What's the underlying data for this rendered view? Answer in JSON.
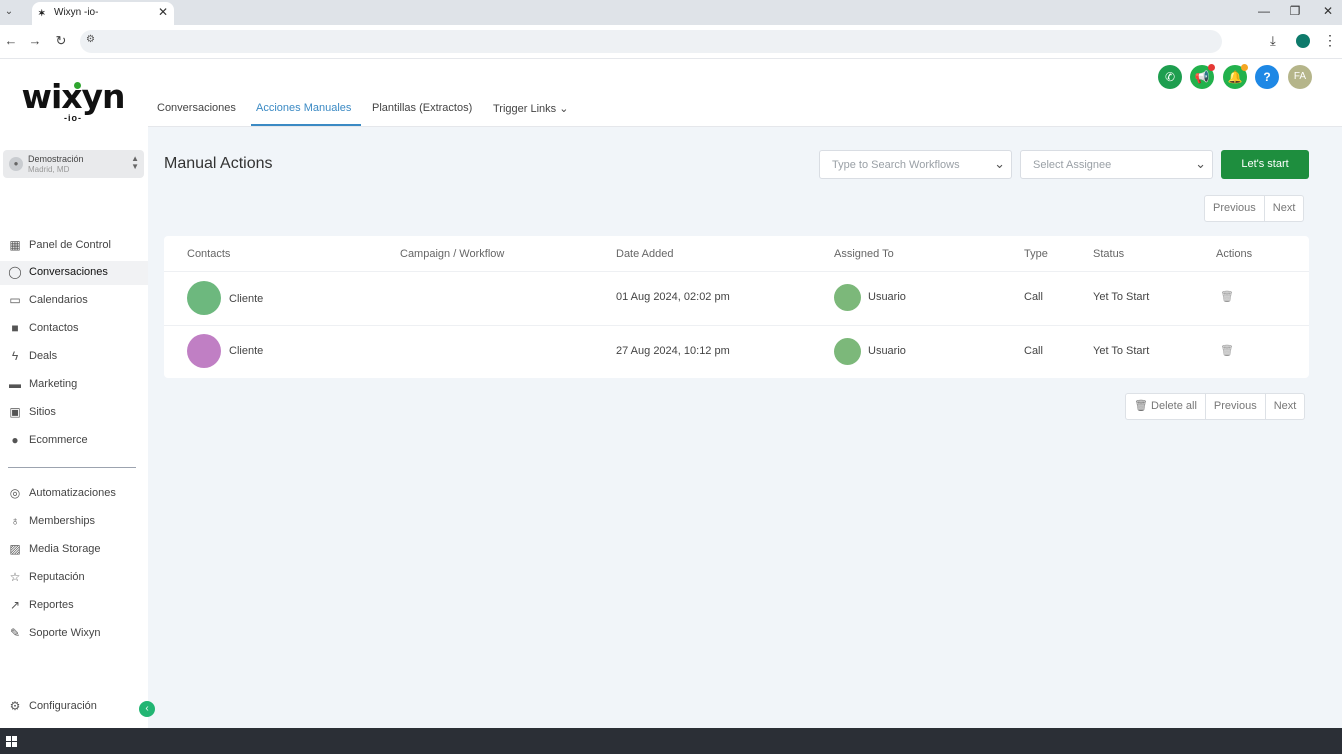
{
  "browser": {
    "tab_title": "Wixyn -io-",
    "tab_favicon": "wixyn",
    "window_controls": [
      "minimize",
      "restore",
      "close"
    ]
  },
  "sidebar": {
    "logo_text": "wixyn",
    "logo_sub": "-io-",
    "location": {
      "name": "Demostración",
      "sub": "Madrid, MD"
    },
    "items": [
      {
        "label": "Panel de Control",
        "icon": "grid-icon"
      },
      {
        "label": "Conversaciones",
        "icon": "chat-icon",
        "active": true
      },
      {
        "label": "Calendarios",
        "icon": "calendar-icon"
      },
      {
        "label": "Contactos",
        "icon": "contacts-icon"
      },
      {
        "label": "Deals",
        "icon": "bolt-icon"
      },
      {
        "label": "Marketing",
        "icon": "ad-icon"
      },
      {
        "label": "Sitios",
        "icon": "sites-icon"
      },
      {
        "label": "Ecommerce",
        "icon": "ecommerce-icon"
      },
      {
        "label": "Automatizaciones",
        "icon": "automation-icon"
      },
      {
        "label": "Memberships",
        "icon": "badge-icon"
      },
      {
        "label": "Media Storage",
        "icon": "image-icon"
      },
      {
        "label": "Reputación",
        "icon": "star-icon"
      },
      {
        "label": "Reportes",
        "icon": "trend-icon"
      },
      {
        "label": "Soporte Wixyn",
        "icon": "wrench-icon"
      }
    ],
    "settings_label": "Configuración"
  },
  "header": {
    "tabs": [
      {
        "label": "Conversaciones"
      },
      {
        "label": "Acciones Manuales",
        "active": true
      },
      {
        "label": "Plantillas (Extractos)"
      },
      {
        "label": "Trigger Links ⌄"
      }
    ],
    "icons": [
      {
        "name": "phone-icon",
        "color": "#1e9e4f"
      },
      {
        "name": "megaphone-icon",
        "color": "#22b14c"
      },
      {
        "name": "bell-icon",
        "color": "#22b14c"
      },
      {
        "name": "help-icon",
        "color": "#1e88e5"
      }
    ],
    "avatar_initials": "FA",
    "avatar_color": "#b5b58a"
  },
  "main": {
    "title": "Manual Actions",
    "workflow_search_placeholder": "Type to Search Workflows",
    "assignee_placeholder": "Select Assignee",
    "start_button": "Let's start",
    "pager_top": {
      "previous": "Previous",
      "next": "Next"
    },
    "pager_bottom": {
      "delete_all": "Delete all",
      "previous": "Previous",
      "next": "Next"
    },
    "accent_color": "#1e8e3e"
  },
  "table": {
    "columns": [
      "Contacts",
      "Campaign / Workflow",
      "Date Added",
      "Assigned To",
      "Type",
      "Status",
      "Actions"
    ],
    "rows": [
      {
        "contact": "Cliente",
        "contact_color": "#6db87e",
        "workflow": "",
        "date": "01 Aug 2024, 02:02 pm",
        "assigned": "Usuario",
        "assigned_color": "#7cb87a",
        "type": "Call",
        "status": "Yet To Start"
      },
      {
        "contact": "Cliente",
        "contact_color": "#c07fc4",
        "workflow": "",
        "date": "27 Aug 2024, 10:12 pm",
        "assigned": "Usuario",
        "assigned_color": "#7cb87a",
        "type": "Call",
        "status": "Yet To Start"
      }
    ]
  }
}
